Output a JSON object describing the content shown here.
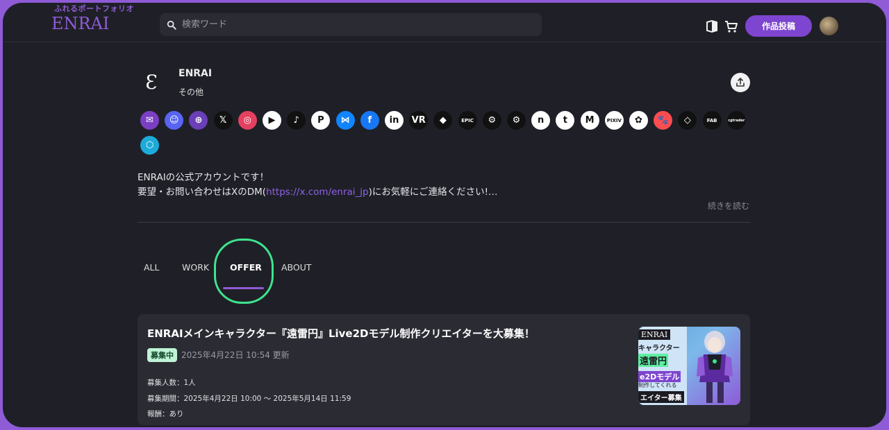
{
  "header": {
    "logo_sub": "ふれるポートフォリオ",
    "logo_main": "ENRAI",
    "search_placeholder": "検索ワード",
    "post_button": "作品投稿"
  },
  "profile": {
    "name": "ENRAI",
    "category": "その他",
    "bio_line1": "ENRAIの公式アカウントです！",
    "bio_line2_pre": "要望・お問い合わせはXのDM(",
    "bio_link": "https://x.com/enrai_jp",
    "bio_line2_post": ")にお気軽にご連絡ください!…",
    "read_more": "続きを読む"
  },
  "socials": [
    {
      "name": "mail-icon",
      "color": "#7b3fc4",
      "glyph": "✉"
    },
    {
      "name": "discord-icon",
      "color": "#5865f2",
      "glyph": "☺"
    },
    {
      "name": "website-icon",
      "color": "#6a3fb8",
      "glyph": "⊕"
    },
    {
      "name": "x-icon",
      "color": "#111111",
      "glyph": "𝕏"
    },
    {
      "name": "instagram-icon",
      "color": "#e4405f",
      "glyph": "◎"
    },
    {
      "name": "youtube-icon",
      "color": "#ffffff",
      "glyph": "▶"
    },
    {
      "name": "tiktok-icon",
      "color": "#111111",
      "glyph": "♪"
    },
    {
      "name": "pinterest-icon",
      "color": "#ffffff",
      "glyph": "P"
    },
    {
      "name": "bluesky-icon",
      "color": "#1185fe",
      "glyph": "⋈"
    },
    {
      "name": "facebook-icon",
      "color": "#1877f2",
      "glyph": "f"
    },
    {
      "name": "linkedin-icon",
      "color": "#ffffff",
      "glyph": "in"
    },
    {
      "name": "vrchat-icon",
      "color": "#111111",
      "glyph": "VR"
    },
    {
      "name": "roblox-icon",
      "color": "#111111",
      "glyph": "◆"
    },
    {
      "name": "epic-games-icon",
      "color": "#111111",
      "glyph": "EPIC"
    },
    {
      "name": "steam-icon",
      "color": "#111111",
      "glyph": "⚙"
    },
    {
      "name": "steam-alt-icon",
      "color": "#111111",
      "glyph": "⚙"
    },
    {
      "name": "note-icon",
      "color": "#ffffff",
      "glyph": "n"
    },
    {
      "name": "tumblr-icon",
      "color": "#ffffff",
      "glyph": "t"
    },
    {
      "name": "medium-icon",
      "color": "#ffffff",
      "glyph": "M"
    },
    {
      "name": "pixiv-fanbox-icon",
      "color": "#ffffff",
      "glyph": "PIXIV"
    },
    {
      "name": "openai-icon",
      "color": "#ffffff",
      "glyph": "✿"
    },
    {
      "name": "booth-icon",
      "color": "#fc4d50",
      "glyph": "🐾"
    },
    {
      "name": "unity-icon",
      "color": "#111111",
      "glyph": "◇"
    },
    {
      "name": "fab-icon",
      "color": "#111111",
      "glyph": "FAB"
    },
    {
      "name": "cgtrader-icon",
      "color": "#111111",
      "glyph": "cgtrader"
    },
    {
      "name": "sketchfab-icon",
      "color": "#1caad9",
      "glyph": "⬡"
    }
  ],
  "tabs": [
    {
      "label": "ALL"
    },
    {
      "label": "WORK"
    },
    {
      "label": "OFFER"
    },
    {
      "label": "ABOUT"
    }
  ],
  "offer": {
    "title": "ENRAIメインキャラクター『遠雷円』Live2Dモデル制作クリエイターを大募集！",
    "status": "募集中",
    "updated": "2025年4月22日 10:54 更新",
    "recruits": "募集人数：1人",
    "period": "募集期間：2025年4月22日 10:00 〜 2025年5月14日 11:59",
    "reward": "報酬：あり",
    "thumb_brand": "ENRAI",
    "thumb_line1": "キャラクター",
    "thumb_line2": "遠雷円",
    "thumb_line3": "e2Dモデル",
    "thumb_line4": "制作してくれる",
    "thumb_line5": "エイター募集"
  }
}
